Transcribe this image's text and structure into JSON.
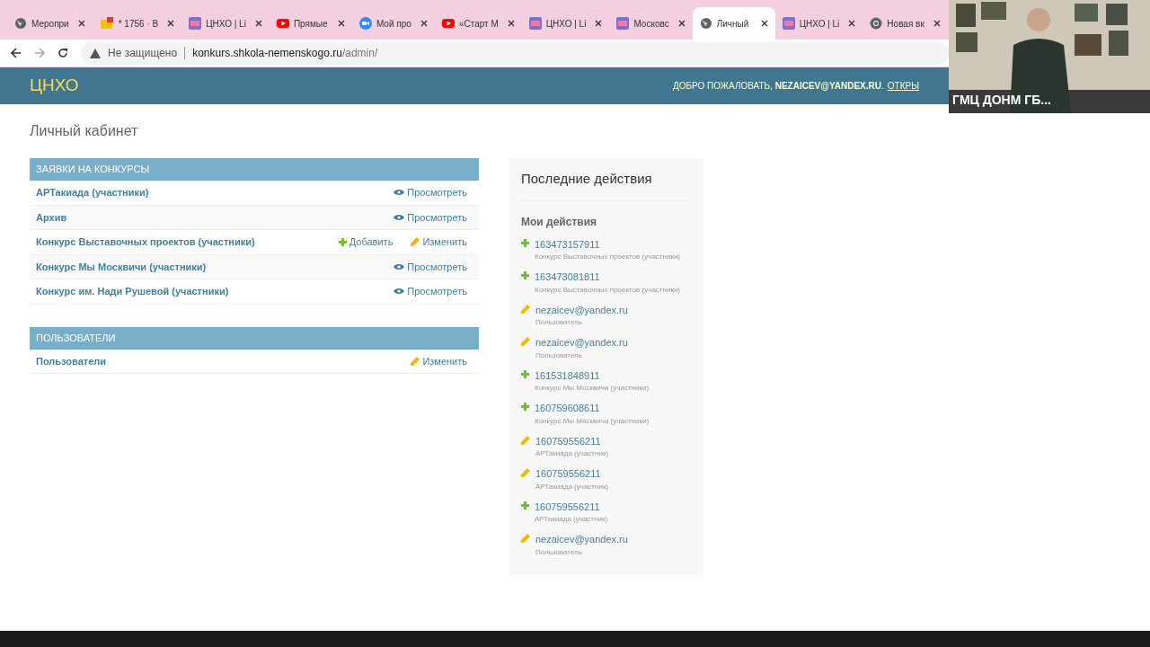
{
  "browser": {
    "tabs": [
      {
        "kind": "globe",
        "title": "Меропри",
        "selected": false
      },
      {
        "kind": "mail",
        "title": "* 1756 · В",
        "selected": false
      },
      {
        "kind": "site",
        "title": "ЦНХО | Li",
        "selected": false
      },
      {
        "kind": "video",
        "title": "Прямые",
        "selected": false
      },
      {
        "kind": "camera",
        "title": "Мой про",
        "selected": false
      },
      {
        "kind": "video",
        "title": "«Старт М",
        "selected": false
      },
      {
        "kind": "site",
        "title": "ЦНХО | Li",
        "selected": false
      },
      {
        "kind": "site",
        "title": "Московс",
        "selected": false
      },
      {
        "kind": "globe",
        "title": "Личный",
        "selected": true
      },
      {
        "kind": "site",
        "title": "ЦНХО | Li",
        "selected": false
      },
      {
        "kind": "chrome",
        "title": "Новая вк",
        "selected": false
      }
    ],
    "security": "Не защищено",
    "url_host": "konkurs.shkola-nemenskogo.ru",
    "url_path": "/admin/"
  },
  "header": {
    "brand": "ЦНХО",
    "welcome": "ДОБРО ПОЖАЛОВАТЬ, **NEZAICEV@YANDEX.RU**.",
    "link": "ОТКРЫ"
  },
  "page_title": "Личный кабинет",
  "modules": [
    {
      "caption": "ЗАЯВКИ НА КОНКУРСЫ",
      "rows": [
        {
          "name": "АРТакиада (участники)",
          "actions": [
            {
              "kind": "view",
              "label": "Просмотреть"
            }
          ]
        },
        {
          "name": "Архив",
          "actions": [
            {
              "kind": "view",
              "label": "Просмотреть"
            }
          ]
        },
        {
          "name": "Конкурс Выставочных проектов (участники)",
          "actions": [
            {
              "kind": "add",
              "label": "Добавить"
            },
            {
              "kind": "change",
              "label": "Изменить"
            }
          ]
        },
        {
          "name": "Конкурс Мы Москвичи (участники)",
          "actions": [
            {
              "kind": "view",
              "label": "Просмотреть"
            }
          ]
        },
        {
          "name": "Конкурс им. Нади Рушевой (участники)",
          "actions": [
            {
              "kind": "view",
              "label": "Просмотреть"
            }
          ]
        }
      ]
    },
    {
      "caption": "ПОЛЬЗОВАТЕЛИ",
      "rows": [
        {
          "name": "Пользователи",
          "actions": [
            {
              "kind": "change",
              "label": "Изменить"
            }
          ]
        }
      ]
    }
  ],
  "recent": {
    "title": "Последние действия",
    "subtitle": "Мои действия",
    "items": [
      {
        "kind": "add",
        "title": "163473157911",
        "type": "Конкурс Выставочных проектов (участники)"
      },
      {
        "kind": "add",
        "title": "163473081811",
        "type": "Конкурс Выставочных проектов (участники)"
      },
      {
        "kind": "change",
        "title": "nezaicev@yandex.ru",
        "type": "Пользователь"
      },
      {
        "kind": "change",
        "title": "nezaicev@yandex.ru",
        "type": "Пользователь"
      },
      {
        "kind": "add",
        "title": "161531848911",
        "type": "Конкурс Мы Москвичи (участники)"
      },
      {
        "kind": "add",
        "title": "160759608611",
        "type": "Конкурс Мы Москвичи (участники)"
      },
      {
        "kind": "change",
        "title": "160759556211",
        "type": "АРТакиада (участник)"
      },
      {
        "kind": "change",
        "title": "160759556211",
        "type": "АРТакиада (участник)"
      },
      {
        "kind": "add",
        "title": "160759556211",
        "type": "АРТакиада (участник)"
      },
      {
        "kind": "change",
        "title": "nezaicev@yandex.ru",
        "type": "Пользователь"
      }
    ]
  },
  "video": {
    "kind": "picture",
    "caption": "ГМЦ ДОНМ ГБ..."
  }
}
